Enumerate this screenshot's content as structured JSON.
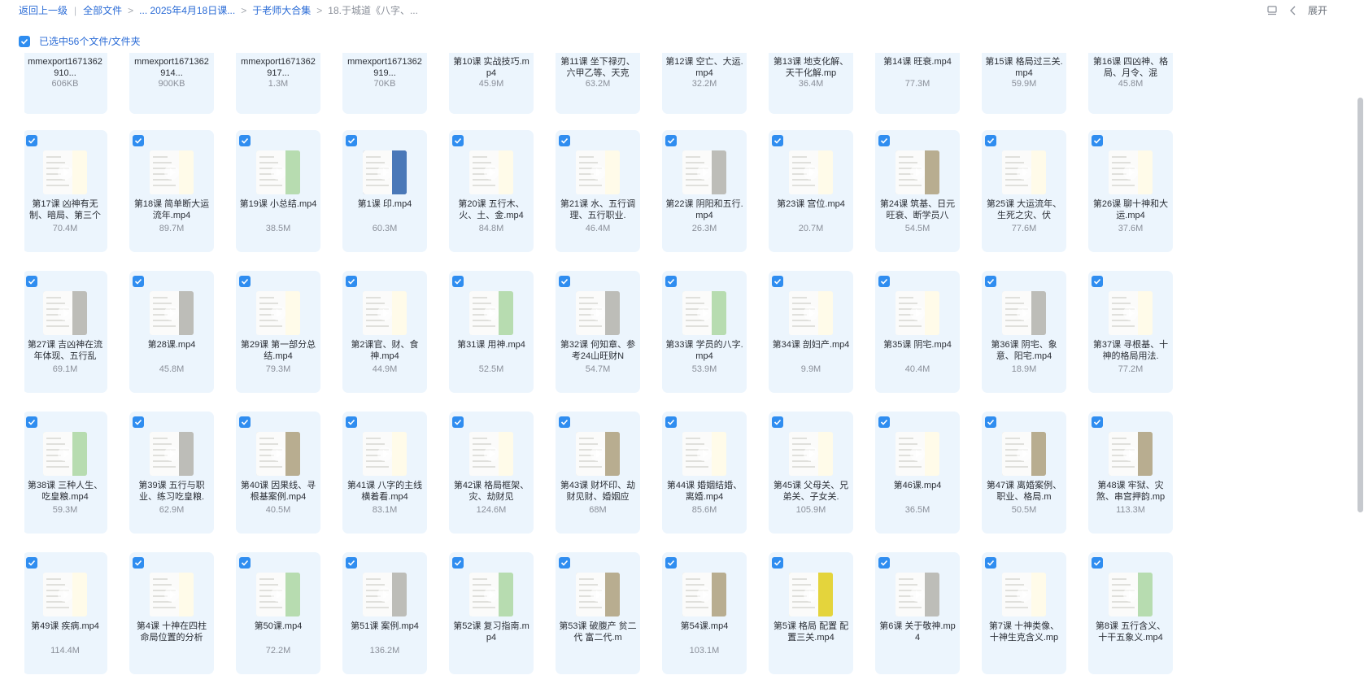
{
  "breadcrumb": {
    "back": "返回上一级",
    "items": [
      "全部文件",
      "... 2025年4月18日课...",
      "于老师大合集"
    ],
    "current": "18.于城道《八字、..."
  },
  "toolbar": {
    "expand_label": "展开"
  },
  "selection": {
    "text": "已选中56个文件/文件夹"
  },
  "colors": {
    "accent": "#2f8df0",
    "link": "#2a6bd6",
    "card_bg": "#ecf5fd"
  },
  "files": [
    {
      "name": "mmexport1671362910...",
      "size": "606KB",
      "kind": "image",
      "tint": ""
    },
    {
      "name": "mmexport1671362914...",
      "size": "900KB",
      "kind": "image",
      "tint": ""
    },
    {
      "name": "mmexport1671362917...",
      "size": "1.3M",
      "kind": "image",
      "tint": ""
    },
    {
      "name": "mmexport1671362919...",
      "size": "70KB",
      "kind": "image",
      "tint": ""
    },
    {
      "name": "第10课 实战技巧.mp4",
      "size": "45.9M",
      "kind": "video",
      "tint": ""
    },
    {
      "name": "第11课 坐下禄刃、六甲乙等、天克",
      "size": "63.2M",
      "kind": "video",
      "tint": ""
    },
    {
      "name": "第12课 空亡、大运.mp4",
      "size": "32.2M",
      "kind": "video",
      "tint": ""
    },
    {
      "name": "第13课 地支化解、天干化解.mp",
      "size": "36.4M",
      "kind": "video",
      "tint": ""
    },
    {
      "name": "第14课 旺衰.mp4",
      "size": "77.3M",
      "kind": "video",
      "tint": ""
    },
    {
      "name": "第15课 格局过三关.mp4",
      "size": "59.9M",
      "kind": "video",
      "tint": ""
    },
    {
      "name": "第16课 四凶神、格局、月令、混",
      "size": "45.8M",
      "kind": "video",
      "tint": ""
    },
    {
      "name": "第17课 凶神有无制、暗局、第三个",
      "size": "70.4M",
      "kind": "video",
      "tint": "cream"
    },
    {
      "name": "第18课 简单断大运流年.mp4",
      "size": "89.7M",
      "kind": "video",
      "tint": "cream"
    },
    {
      "name": "第19课 小总结.mp4",
      "size": "38.5M",
      "kind": "video",
      "tint": "green"
    },
    {
      "name": "第1课 印.mp4",
      "size": "60.3M",
      "kind": "video",
      "tint": "blue"
    },
    {
      "name": "第20课 五行木、火、土、金.mp4",
      "size": "84.8M",
      "kind": "video",
      "tint": "cream"
    },
    {
      "name": "第21课 水、五行调理、五行职业.",
      "size": "46.4M",
      "kind": "video",
      "tint": "cream"
    },
    {
      "name": "第22课 阴阳和五行.mp4",
      "size": "26.3M",
      "kind": "video",
      "tint": "gray"
    },
    {
      "name": "第23课 宫位.mp4",
      "size": "20.7M",
      "kind": "video",
      "tint": "cream"
    },
    {
      "name": "第24课 筑基、日元旺衰、断学员八",
      "size": "54.5M",
      "kind": "video",
      "tint": "tan"
    },
    {
      "name": "第25课 大运流年、生死之灾、伏",
      "size": "77.6M",
      "kind": "video",
      "tint": "cream"
    },
    {
      "name": "第26课 聊十神和大运.mp4",
      "size": "37.6M",
      "kind": "video",
      "tint": "cream"
    },
    {
      "name": "第27课 吉凶神在流年体现、五行乱",
      "size": "69.1M",
      "kind": "video",
      "tint": "gray"
    },
    {
      "name": "第28课.mp4",
      "size": "45.8M",
      "kind": "video",
      "tint": "gray"
    },
    {
      "name": "第29课 第一部分总结.mp4",
      "size": "79.3M",
      "kind": "video",
      "tint": "cream"
    },
    {
      "name": "第2课官、财、食神.mp4",
      "size": "44.9M",
      "kind": "video",
      "tint": "cream"
    },
    {
      "name": "第31课 用神.mp4",
      "size": "52.5M",
      "kind": "video",
      "tint": "green"
    },
    {
      "name": "第32课 何知章、参考24山旺财N",
      "size": "54.7M",
      "kind": "video",
      "tint": "gray"
    },
    {
      "name": "第33课 学员的八字.mp4",
      "size": "53.9M",
      "kind": "video",
      "tint": "green"
    },
    {
      "name": "第34课 剖妇产.mp4",
      "size": "9.9M",
      "kind": "video",
      "tint": "cream"
    },
    {
      "name": "第35课 阴宅.mp4",
      "size": "40.4M",
      "kind": "video",
      "tint": "cream"
    },
    {
      "name": "第36课 阴宅、象意、阳宅.mp4",
      "size": "18.9M",
      "kind": "video",
      "tint": "gray"
    },
    {
      "name": "第37课 寻根基、十神的格局用法.",
      "size": "77.2M",
      "kind": "video",
      "tint": "cream"
    },
    {
      "name": "第38课 三种人生、吃皇粮.mp4",
      "size": "59.3M",
      "kind": "video",
      "tint": "green"
    },
    {
      "name": "第39课 五行与职业、练习吃皇粮.",
      "size": "62.9M",
      "kind": "video",
      "tint": "gray"
    },
    {
      "name": "第40课 因果线、寻根基案例.mp4",
      "size": "40.5M",
      "kind": "video",
      "tint": "tan"
    },
    {
      "name": "第41课 八字的主线 横着看.mp4",
      "size": "83.1M",
      "kind": "video",
      "tint": "cream"
    },
    {
      "name": "第42课 格局框架、灾、劫财见",
      "size": "124.6M",
      "kind": "video",
      "tint": "cream"
    },
    {
      "name": "第43课 财坏印、劫财见财、婚姻应",
      "size": "68M",
      "kind": "video",
      "tint": "tan"
    },
    {
      "name": "第44课 婚姻结婚、离婚.mp4",
      "size": "85.6M",
      "kind": "video",
      "tint": "cream"
    },
    {
      "name": "第45课 父母关、兄弟关、子女关.",
      "size": "105.9M",
      "kind": "video",
      "tint": "cream"
    },
    {
      "name": "第46课.mp4",
      "size": "36.5M",
      "kind": "video",
      "tint": "cream"
    },
    {
      "name": "第47课 离婚案例、职业、格局.m",
      "size": "50.5M",
      "kind": "video",
      "tint": "tan"
    },
    {
      "name": "第48课 牢狱、灾煞、串宫押韵.mp",
      "size": "113.3M",
      "kind": "video",
      "tint": "tan"
    },
    {
      "name": "第49课 疾病.mp4",
      "size": "114.4M",
      "kind": "video",
      "tint": "cream"
    },
    {
      "name": "第4课 十神在四柱命局位置的分析",
      "size": "",
      "kind": "video",
      "tint": "cream"
    },
    {
      "name": "第50课.mp4",
      "size": "72.2M",
      "kind": "video",
      "tint": "green"
    },
    {
      "name": "第51课 案例.mp4",
      "size": "136.2M",
      "kind": "video",
      "tint": "gray"
    },
    {
      "name": "第52课 复习指南.mp4",
      "size": "",
      "kind": "video",
      "tint": "green"
    },
    {
      "name": "第53课 破腹产 贫二代 富二代.m",
      "size": "",
      "kind": "video",
      "tint": "tan"
    },
    {
      "name": "第54课.mp4",
      "size": "103.1M",
      "kind": "video",
      "tint": "tan"
    },
    {
      "name": "第5课 格局 配置 配置三关.mp4",
      "size": "",
      "kind": "video",
      "tint": "yellow"
    },
    {
      "name": "第6课 关于敬神.mp4",
      "size": "",
      "kind": "video",
      "tint": "gray"
    },
    {
      "name": "第7课 十神类像、十神生克含义.mp",
      "size": "",
      "kind": "video",
      "tint": "cream"
    },
    {
      "name": "第8课 五行含义、十干五象义.mp4",
      "size": "",
      "kind": "video",
      "tint": "green"
    }
  ]
}
